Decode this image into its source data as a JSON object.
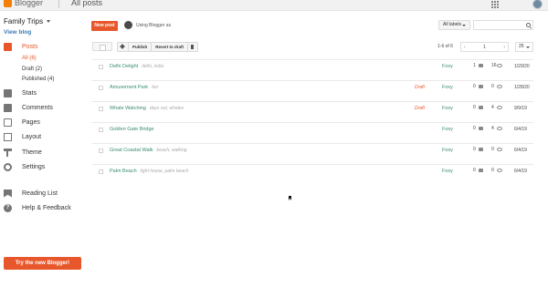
{
  "app": {
    "brand": "Blogger",
    "page_title": "All posts"
  },
  "blog": {
    "name": "Family Trips",
    "view_link": "View blog"
  },
  "sidebar": {
    "items": [
      {
        "label": "Posts",
        "icon": "posts-icon"
      },
      {
        "label": "Stats",
        "icon": "stats-icon"
      },
      {
        "label": "Comments",
        "icon": "comments-icon"
      },
      {
        "label": "Pages",
        "icon": "pages-icon"
      },
      {
        "label": "Layout",
        "icon": "layout-icon"
      },
      {
        "label": "Theme",
        "icon": "theme-icon"
      },
      {
        "label": "Settings",
        "icon": "settings-icon"
      },
      {
        "label": "Reading List",
        "icon": "reading-list-icon"
      },
      {
        "label": "Help & Feedback",
        "icon": "help-icon"
      }
    ],
    "sub_items": [
      "All (6)",
      "Draft (2)",
      "Published (4)"
    ],
    "try_new": "Try the new Blogger!"
  },
  "toolbar": {
    "new_post": "New post",
    "using_as": "Using Blogger as",
    "labels_filter": "All labels",
    "publish": "Publish",
    "revert": "Revert to draft",
    "range": "1-6 of 6",
    "page": "1",
    "per_page": "25"
  },
  "posts": [
    {
      "title": "Delhi Delight",
      "labels": "delhi, india",
      "status": "",
      "author": "Foxy",
      "comments": "1",
      "views": "16",
      "date": "1/29/20"
    },
    {
      "title": "Amusement Park",
      "labels": "fun",
      "status": "Draft",
      "author": "Foxy",
      "comments": "0",
      "views": "0",
      "date": "1/28/20"
    },
    {
      "title": "Whale Watching",
      "labels": "days out, whales",
      "status": "Draft",
      "author": "Foxy",
      "comments": "0",
      "views": "4",
      "date": "9/9/19"
    },
    {
      "title": "Golden Gate Bridge",
      "labels": "",
      "status": "",
      "author": "Foxy",
      "comments": "0",
      "views": "4",
      "date": "6/4/19"
    },
    {
      "title": "Great Coastal Walk",
      "labels": "beach, walking",
      "status": "",
      "author": "Foxy",
      "comments": "0",
      "views": "0",
      "date": "6/4/19"
    },
    {
      "title": "Palm Beach",
      "labels": "light house, palm beach",
      "status": "",
      "author": "Foxy",
      "comments": "0",
      "views": "0",
      "date": "6/4/19"
    }
  ],
  "colors": {
    "accent": "#e8572b",
    "link": "#3b8a73"
  }
}
